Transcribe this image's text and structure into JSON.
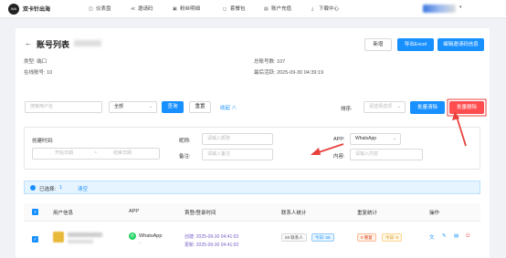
{
  "topbar": {
    "logo_text": "WA",
    "brand": "双卡针出海",
    "nav": [
      {
        "icon": "dashboard-icon",
        "glyph": "◫",
        "label": "仪表盘"
      },
      {
        "icon": "share-icon",
        "glyph": "≪",
        "label": "邀请码"
      },
      {
        "icon": "fans-icon",
        "glyph": "▣",
        "label": "粉丝明细"
      },
      {
        "icon": "package-icon",
        "glyph": "◻",
        "label": "套餐包"
      },
      {
        "icon": "recharge-icon",
        "glyph": "▤",
        "label": "账户充值"
      },
      {
        "icon": "download-icon",
        "glyph": "⤓",
        "label": "下载中心"
      }
    ]
  },
  "page": {
    "back_glyph": "←",
    "title": "账号列表",
    "buttons": {
      "new": "新增",
      "export": "导出Excel",
      "edit_invite": "编辑邀请码信息"
    },
    "meta": {
      "type_label": "类型:",
      "type_value": "端口",
      "online_label": "在线账号:",
      "online_value": "10",
      "total_label": "总账号数:",
      "total_value": "107",
      "last_active_label": "最后活跃:",
      "last_active_value": "2025-09-30 04:39:19"
    }
  },
  "search": {
    "username_placeholder": "搜索用户名",
    "status_value": "全部",
    "query": "查询",
    "reset": "重置",
    "collapse": "收起 ∧",
    "sort_label": "排序:",
    "sort_placeholder": "请选择选项",
    "batch_clear": "批量清除",
    "batch_delete": "批量删除"
  },
  "filters": {
    "created_label": "创建时间:",
    "start_placeholder": "开始日期",
    "range_sep": "~",
    "end_placeholder": "结束日期",
    "nickname_label": "昵称:",
    "nickname_placeholder": "请输入昵称",
    "remark_label": "备注:",
    "remark_placeholder": "请输入备注",
    "app_label": "APP:",
    "app_value": "WhatsApp",
    "content_label": "内容:",
    "content_placeholder": "请输入内容"
  },
  "selection": {
    "selected_label": "已选择:",
    "selected_count": "1",
    "clear": "清空"
  },
  "table": {
    "headers": [
      "用户信息",
      "APP",
      "首登/登录时间",
      "联系人统计",
      "重复统计",
      "操作"
    ],
    "row": {
      "app": "WhatsApp",
      "app_sub": "-",
      "created_label": "创建:",
      "created": "2025-09-30 04:41:03",
      "updated_label": "更新:",
      "updated": "2025-09-30 04:41:03",
      "contacts_tag": "58 联系人",
      "contacts_today": "今日: 58",
      "repeat_tag": "0 重复",
      "repeat_today": "今日: 0"
    }
  },
  "colors": {
    "primary": "#1890ff",
    "danger": "#ff4d4f",
    "annotation": "#e8413c"
  }
}
